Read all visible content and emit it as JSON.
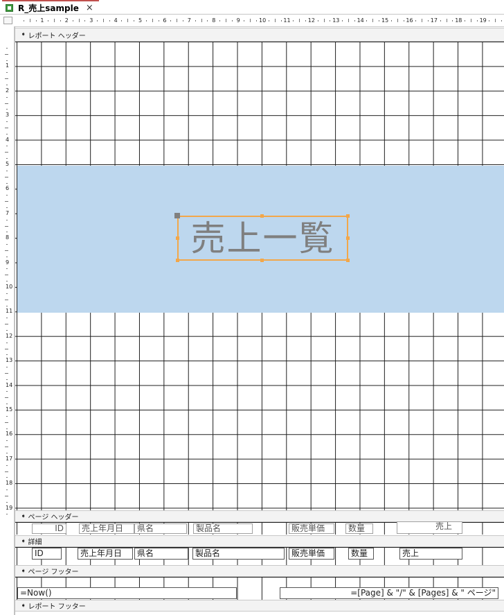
{
  "tab": {
    "title": "R_売上sample",
    "close": "×"
  },
  "ruler": {
    "horizontal": [
      "1",
      "2",
      "3",
      "4",
      "5",
      "6",
      "7",
      "8",
      "9",
      "10",
      "11",
      "12",
      "13",
      "14",
      "15",
      "16",
      "17",
      "18",
      "19"
    ],
    "vertical": [
      "1",
      "2",
      "3",
      "4",
      "5",
      "6",
      "7",
      "8",
      "9",
      "10",
      "11",
      "12",
      "13",
      "14",
      "15",
      "16",
      "17",
      "18",
      "19"
    ]
  },
  "sections": {
    "report_header": "レポート ヘッダー",
    "page_header": "ページ ヘッダー",
    "detail": "詳細",
    "page_footer": "ページ フッター",
    "report_footer": "レポート フッター"
  },
  "report_header": {
    "title": "売上一覧",
    "band_color": "#bdd7ee"
  },
  "page_header": {
    "labels": [
      "ID",
      "売上年月日",
      "県名",
      "製品名",
      "販売単価",
      "数量",
      "売上"
    ]
  },
  "detail": {
    "fields": [
      "ID",
      "売上年月日",
      "県名",
      "製品名",
      "販売単価",
      "数量",
      "売上"
    ]
  },
  "page_footer": {
    "left_expr": "=Now()",
    "right_expr": "=[Page] & \"/\" & [Pages] & \" ページ\""
  },
  "colors": {
    "selection": "#f2a74a",
    "grid": "#1e1e1e",
    "tab_accent": "#c0504d"
  }
}
